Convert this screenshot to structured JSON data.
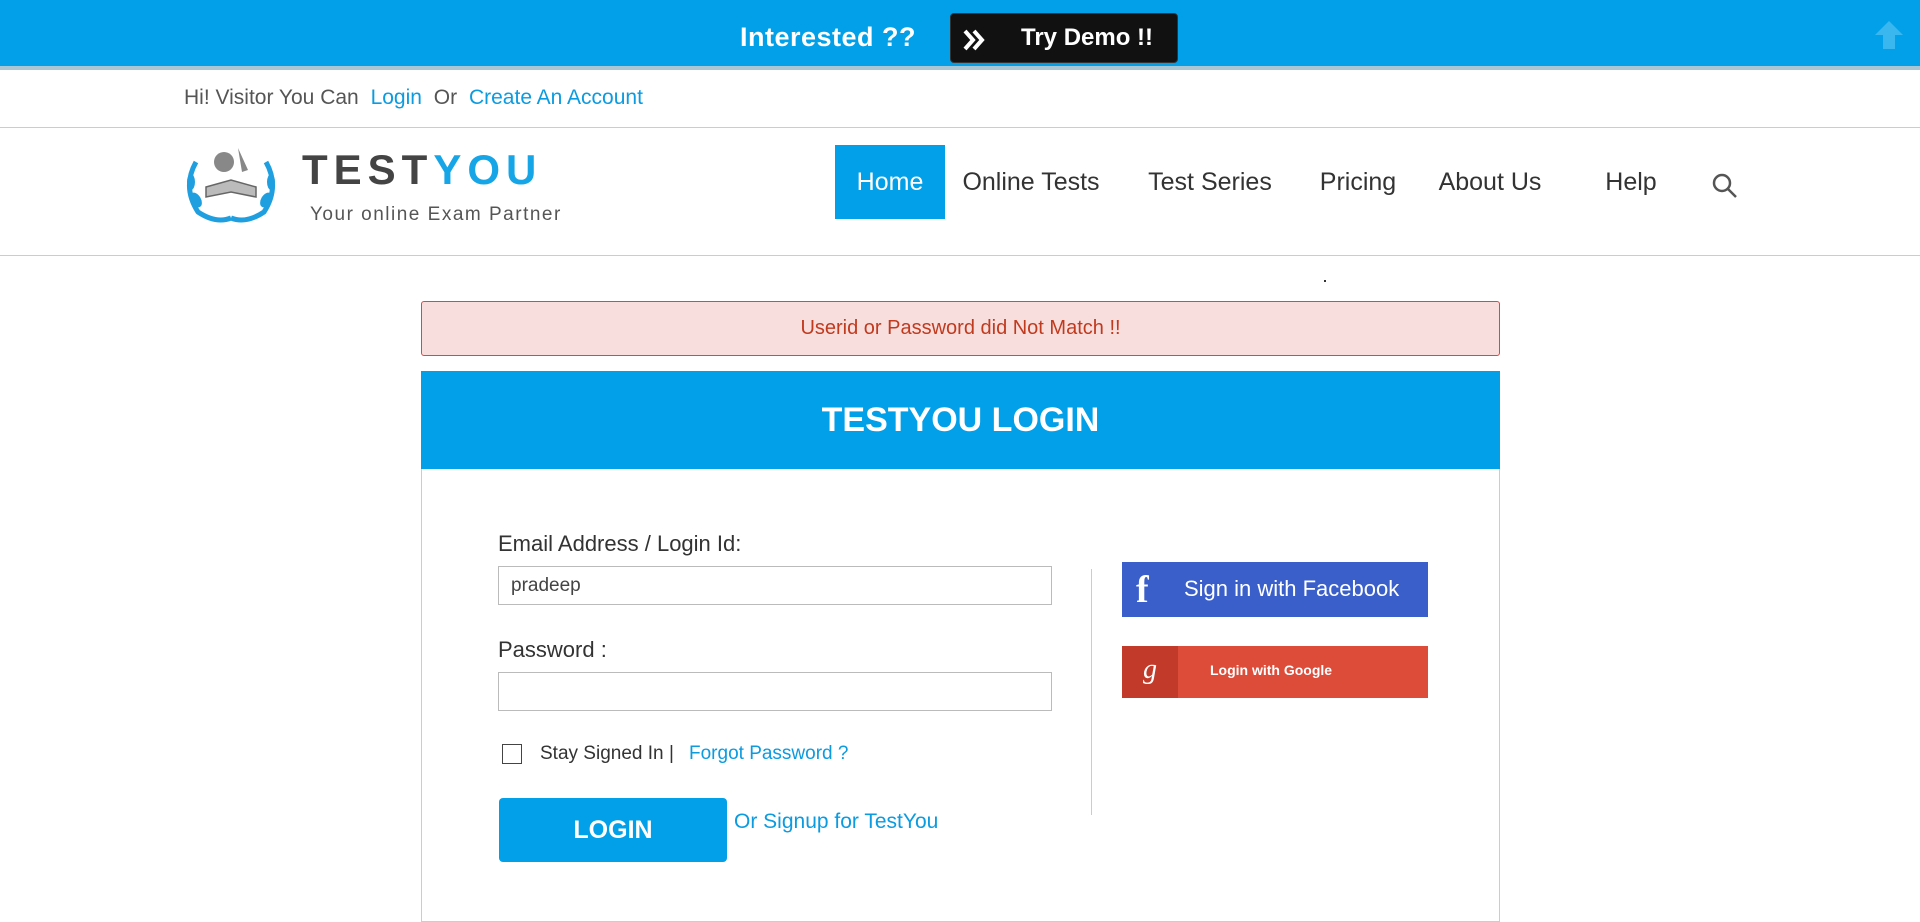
{
  "promo": {
    "text": "Interested ??",
    "demo_label": "Try Demo  !!"
  },
  "visitor": {
    "prefix": "Hi! Visitor You Can",
    "login": "Login",
    "or": "Or",
    "create": "Create An Account"
  },
  "logo": {
    "word_a": "TEST",
    "word_b": "YOU",
    "tagline": "Your online Exam Partner"
  },
  "nav": {
    "items": [
      {
        "label": "Home",
        "active": true
      },
      {
        "label": "Online Tests"
      },
      {
        "label": "Test Series"
      },
      {
        "label": "Pricing"
      },
      {
        "label": "About Us"
      },
      {
        "label": "Help"
      }
    ]
  },
  "alert": {
    "message": "Userid or Password did Not Match !!"
  },
  "login": {
    "title": "TESTYOU LOGIN",
    "email_label": "Email Address / Login Id:",
    "email_value": "pradeep",
    "password_label": "Password :",
    "stay_signed_in": "Stay Signed In",
    "separator": "|",
    "forgot": "Forgot Password ?",
    "button": "LOGIN",
    "signup": "Or Signup for TestYou"
  },
  "social": {
    "facebook": "Sign in with Facebook",
    "facebook_glyph": "f",
    "google": "Login with Google",
    "google_glyph": "g"
  },
  "colors": {
    "brand": "#02a0e9",
    "link": "#0b9be0",
    "alert_bg": "#f9dede",
    "alert_text": "#c03a1e",
    "facebook": "#3a5fcb",
    "google": "#dd4b39"
  }
}
